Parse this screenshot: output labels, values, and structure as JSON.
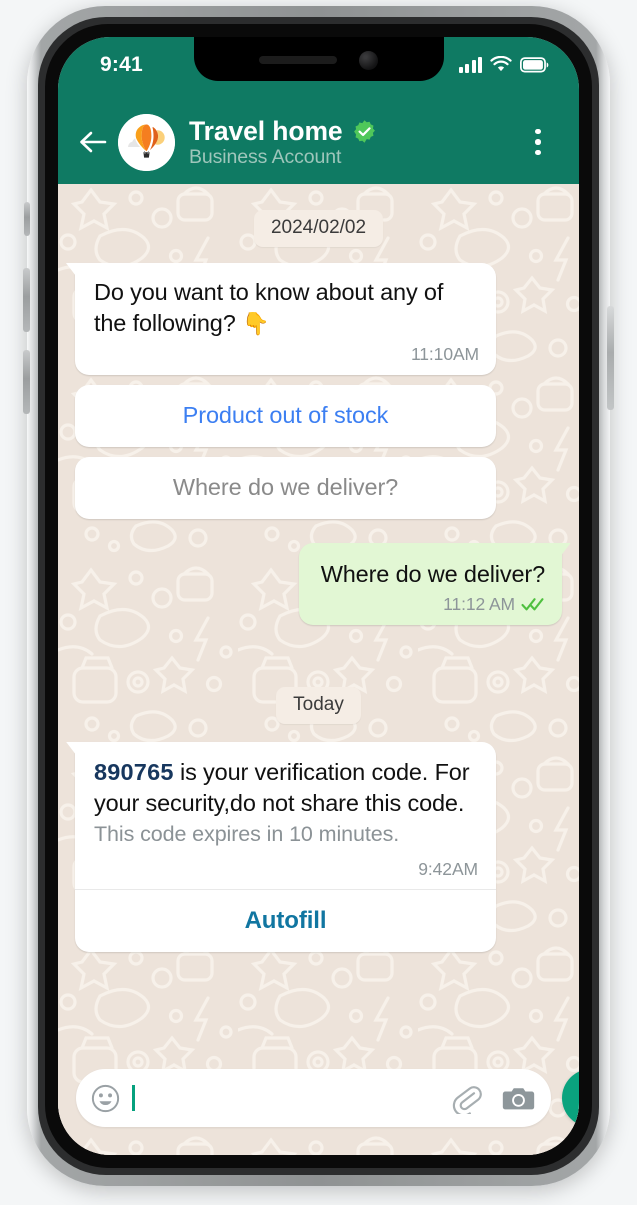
{
  "device": {
    "status_bar": {
      "time": "9:41",
      "icons": [
        "cellular-signal-icon",
        "wifi-icon",
        "battery-icon"
      ]
    }
  },
  "header": {
    "back_icon": "back-arrow-icon",
    "avatar_icon": "hot-air-balloon-avatar",
    "contact_name": "Travel home",
    "verified_badge": "verified-badge-icon",
    "subtitle": "Business Account",
    "menu_icon": "overflow-menu-icon",
    "background_color": "#0F7A63"
  },
  "conversation": {
    "date_separators": {
      "first": "2024/02/02",
      "second": "Today"
    },
    "incoming_message": {
      "text": "Do you want to know about any of the following?",
      "emoji": "👇",
      "time": "11:10AM"
    },
    "quick_replies": [
      {
        "label": "Product out of stock",
        "state": "active",
        "color": "#3C7FF2"
      },
      {
        "label": "Where do we deliver?",
        "state": "disabled",
        "color": "#8a8a8a"
      }
    ],
    "outgoing_message": {
      "text": "Where do we deliver?",
      "time": "11:12 AM",
      "status_icon": "double-check-read-icon",
      "status_color": "#4FC03F",
      "bubble_color": "#E2F7D4"
    },
    "verification_message": {
      "code": "890765",
      "text_after_code": " is your verification code. For your security,do not share this code.",
      "expiry_note": "This code expires in 10 minutes.",
      "time": "9:42AM",
      "action_label": "Autofill",
      "action_color": "#1176A1",
      "code_color": "#17375E"
    }
  },
  "composer": {
    "emoji_icon": "emoji-smiley-icon",
    "input_value": "",
    "input_placeholder": "",
    "attach_icon": "paperclip-icon",
    "camera_icon": "camera-icon",
    "mic_icon": "microphone-icon",
    "mic_button_color": "#0AA37E"
  },
  "theme": {
    "wallpaper_color": "#EDE3DA",
    "header_green": "#0F7A63",
    "incoming_bubble": "#FFFFFF"
  }
}
